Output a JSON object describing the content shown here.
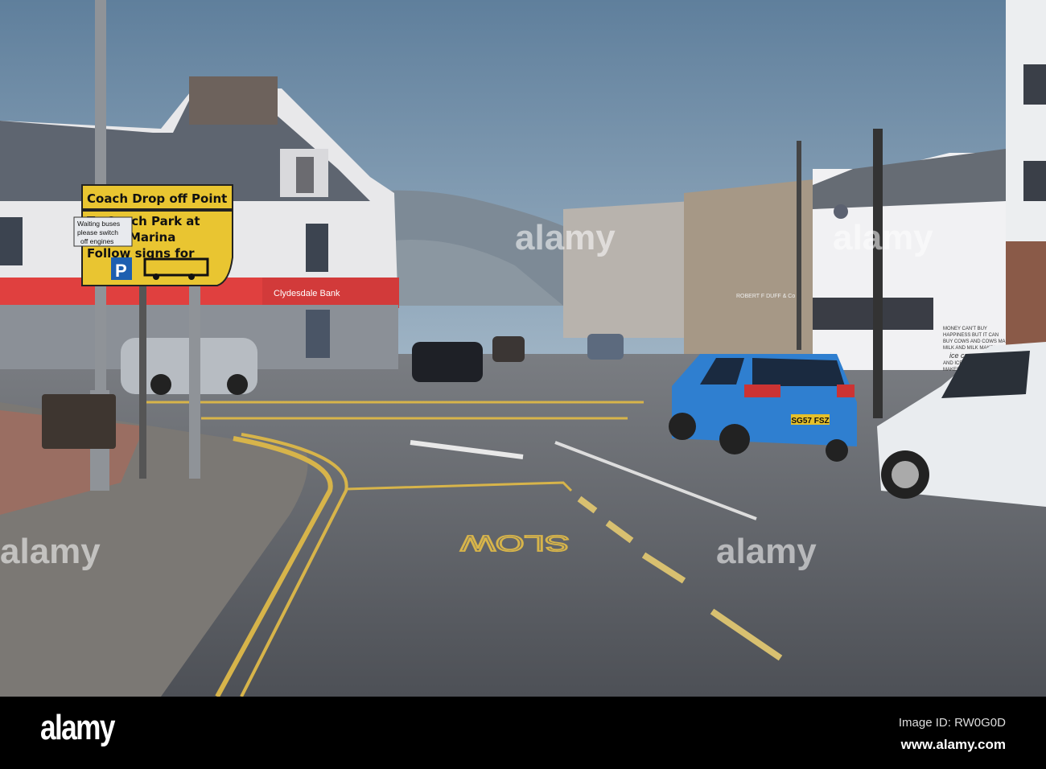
{
  "photo": {
    "coach_sign": {
      "line1": "Coach Drop off Point",
      "line2": "To Coach Park at",
      "line3": "Largs Marina",
      "line4": "Follow signs for"
    },
    "bus_notice": {
      "line1": "Waiting buses",
      "line2": "please switch",
      "line3": "off engines"
    },
    "parking_symbol": "P",
    "bank_name": "Clydesdale Bank",
    "shop_name": "ROBERT F DUFF & Co",
    "mural_text": [
      "MONEY CAN'T BUY",
      "HAPPINESS BUT IT CAN",
      "BUY COWS AND COWS MAKE",
      "MILK AND MILK MAKES",
      "ice cream",
      "AND ICE CREAM",
      "MAKES YOU HAPPY"
    ],
    "number_plate": "SG57 FSZ",
    "road_marking": "SLOW",
    "watermark": "alamy"
  },
  "footer": {
    "logo": "alamy",
    "image_id": "Image ID: RW0G0D",
    "website": "www.alamy.com"
  },
  "colors": {
    "sky_top": "#5f7f9c",
    "sky_bottom": "#c9d6e0",
    "sign_yellow": "#e9c531",
    "bank_red": "#e0403f",
    "car_blue": "#2f7fd0",
    "road": "#55585e"
  }
}
